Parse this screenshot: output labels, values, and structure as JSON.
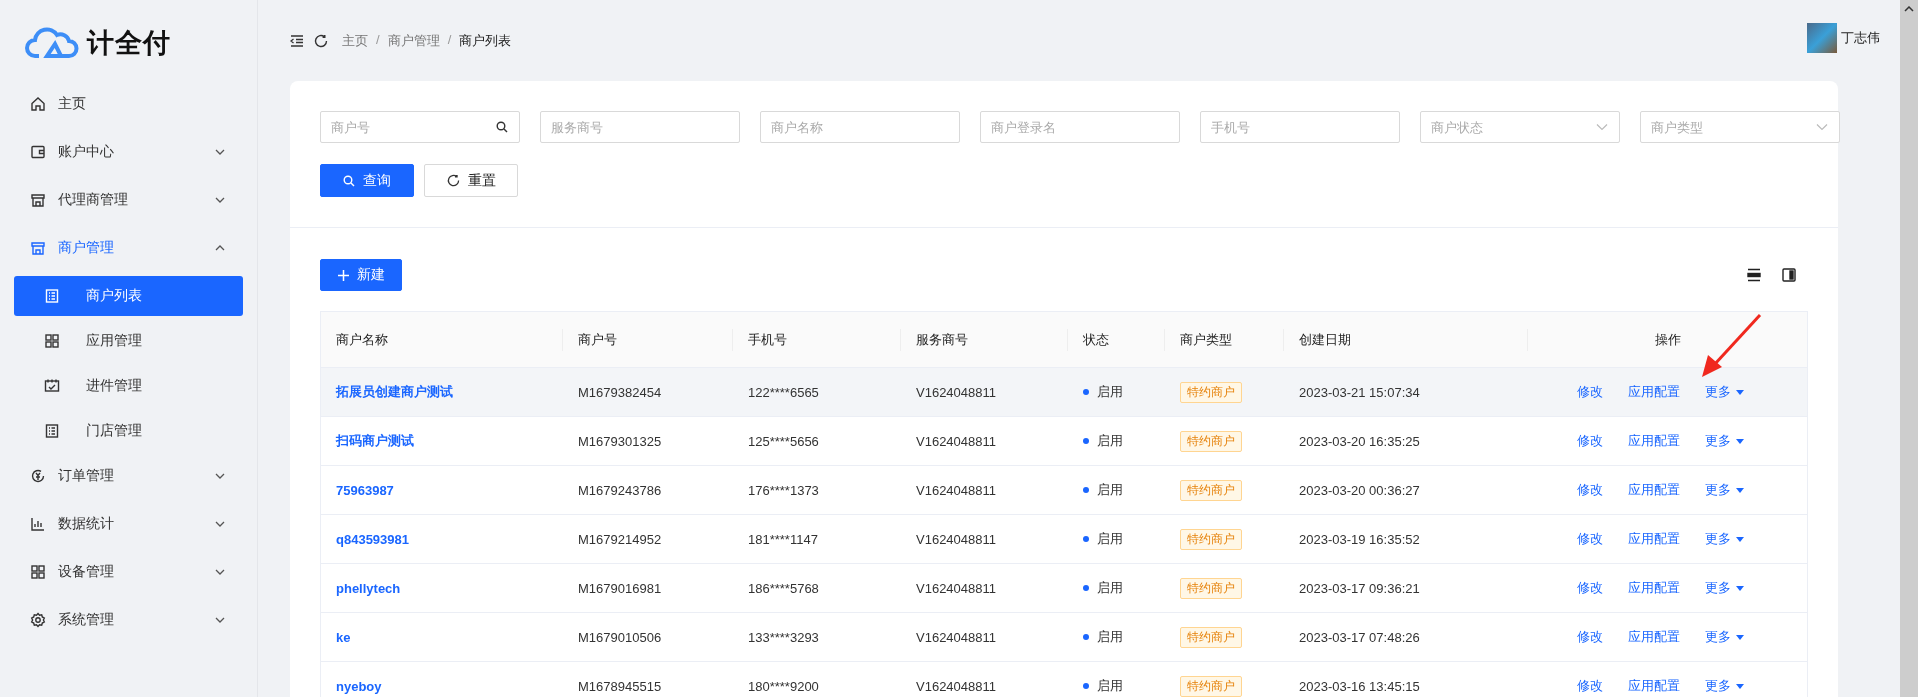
{
  "logo": {
    "text": "计全付"
  },
  "sidebar": {
    "items": [
      {
        "label": "主页",
        "selected": false
      },
      {
        "label": "账户中心",
        "selected": false,
        "expanded": false
      },
      {
        "label": "代理商管理",
        "selected": false,
        "expanded": false
      },
      {
        "label": "商户管理",
        "selected": false,
        "expanded": true,
        "children": [
          {
            "label": "商户列表",
            "selected": true
          },
          {
            "label": "应用管理",
            "selected": false
          },
          {
            "label": "进件管理",
            "selected": false
          },
          {
            "label": "门店管理",
            "selected": false
          }
        ]
      },
      {
        "label": "订单管理",
        "selected": false,
        "expanded": false
      },
      {
        "label": "数据统计",
        "selected": false,
        "expanded": false
      },
      {
        "label": "设备管理",
        "selected": false,
        "expanded": false
      },
      {
        "label": "系统管理",
        "selected": false,
        "expanded": false
      }
    ]
  },
  "breadcrumb": {
    "separator": "/",
    "items": [
      "主页",
      "商户管理",
      "商户列表"
    ]
  },
  "user": {
    "name": "丁志伟"
  },
  "filters": [
    {
      "placeholder": "商户号",
      "kind": "search"
    },
    {
      "placeholder": "服务商号",
      "kind": "text"
    },
    {
      "placeholder": "商户名称",
      "kind": "text"
    },
    {
      "placeholder": "商户登录名",
      "kind": "text"
    },
    {
      "placeholder": "手机号",
      "kind": "text"
    },
    {
      "placeholder": "商户状态",
      "kind": "select"
    },
    {
      "placeholder": "商户类型",
      "kind": "select"
    }
  ],
  "buttons": {
    "query": "查询",
    "reset": "重置",
    "new": "新建"
  },
  "table": {
    "columns": [
      "商户名称",
      "商户号",
      "手机号",
      "服务商号",
      "状态",
      "商户类型",
      "创建日期",
      "操作"
    ],
    "rows": [
      {
        "name": "拓展员创建商户测试",
        "merchant_no": "M1679382454",
        "phone": "122****6565",
        "agent_no": "V1624048811",
        "status": "启用",
        "type": "特约商户",
        "created": "2023-03-21 15:07:34",
        "actions": [
          "修改",
          "应用配置",
          "更多"
        ],
        "hovered": true
      },
      {
        "name": "扫码商户测试",
        "merchant_no": "M1679301325",
        "phone": "125****5656",
        "agent_no": "V1624048811",
        "status": "启用",
        "type": "特约商户",
        "created": "2023-03-20 16:35:25",
        "actions": [
          "修改",
          "应用配置",
          "更多"
        ],
        "hovered": false
      },
      {
        "name": "75963987",
        "merchant_no": "M1679243786",
        "phone": "176****1373",
        "agent_no": "V1624048811",
        "status": "启用",
        "type": "特约商户",
        "created": "2023-03-20 00:36:27",
        "actions": [
          "修改",
          "应用配置",
          "更多"
        ],
        "hovered": false
      },
      {
        "name": "q843593981",
        "merchant_no": "M1679214952",
        "phone": "181****1147",
        "agent_no": "V1624048811",
        "status": "启用",
        "type": "特约商户",
        "created": "2023-03-19 16:35:52",
        "actions": [
          "修改",
          "应用配置",
          "更多"
        ],
        "hovered": false
      },
      {
        "name": "phellytech",
        "merchant_no": "M1679016981",
        "phone": "186****5768",
        "agent_no": "V1624048811",
        "status": "启用",
        "type": "特约商户",
        "created": "2023-03-17 09:36:21",
        "actions": [
          "修改",
          "应用配置",
          "更多"
        ],
        "hovered": false
      },
      {
        "name": "ke",
        "merchant_no": "M1679010506",
        "phone": "133****3293",
        "agent_no": "V1624048811",
        "status": "启用",
        "type": "特约商户",
        "created": "2023-03-17 07:48:26",
        "actions": [
          "修改",
          "应用配置",
          "更多"
        ],
        "hovered": false
      },
      {
        "name": "nyeboy",
        "merchant_no": "M1678945515",
        "phone": "180****9200",
        "agent_no": "V1624048811",
        "status": "启用",
        "type": "特约商户",
        "created": "2023-03-16 13:45:15",
        "actions": [
          "修改",
          "应用配置",
          "更多"
        ],
        "hovered": false
      }
    ]
  }
}
